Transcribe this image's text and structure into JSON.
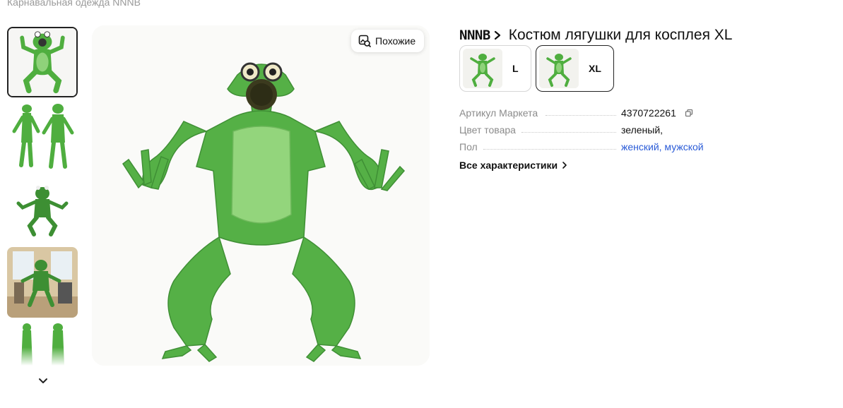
{
  "breadcrumb": {
    "label": "Карнавальная одежда NNNB"
  },
  "gallery": {
    "thumbnails": [
      {
        "alt": "frog-costume-front"
      },
      {
        "alt": "frog-costume-side-back"
      },
      {
        "alt": "frog-costume-pose"
      },
      {
        "alt": "frog-costume-room"
      },
      {
        "alt": "frog-costume-more"
      }
    ],
    "similar_button": "Похожие"
  },
  "product": {
    "brand": "NNNB",
    "title": "Костюм лягушки для косплея XL",
    "variants": [
      {
        "label": "L",
        "selected": false
      },
      {
        "label": "XL",
        "selected": true
      }
    ],
    "specs": [
      {
        "name": "Артикул Маркета",
        "value": "4370722261"
      },
      {
        "name": "Цвет товара",
        "value": "зеленый,"
      },
      {
        "name": "Пол",
        "value": "женский, мужской"
      }
    ],
    "all_specs_link": "Все характеристики"
  },
  "colors": {
    "costume_green": "#4fae3f",
    "belly_green": "#8fd27a",
    "link_blue": "#2a5bd7"
  }
}
